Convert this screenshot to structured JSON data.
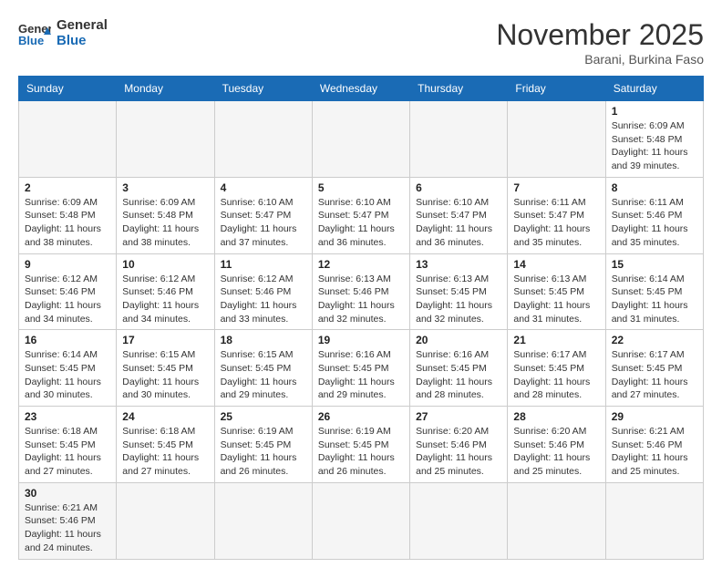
{
  "header": {
    "logo_general": "General",
    "logo_blue": "Blue",
    "month_title": "November 2025",
    "location": "Barani, Burkina Faso"
  },
  "weekdays": [
    "Sunday",
    "Monday",
    "Tuesday",
    "Wednesday",
    "Thursday",
    "Friday",
    "Saturday"
  ],
  "weeks": [
    [
      {
        "day": "",
        "empty": true
      },
      {
        "day": "",
        "empty": true
      },
      {
        "day": "",
        "empty": true
      },
      {
        "day": "",
        "empty": true
      },
      {
        "day": "",
        "empty": true
      },
      {
        "day": "",
        "empty": true
      },
      {
        "day": "1",
        "sunrise": "6:09 AM",
        "sunset": "5:48 PM",
        "daylight": "11 hours and 39 minutes."
      }
    ],
    [
      {
        "day": "2",
        "sunrise": "6:09 AM",
        "sunset": "5:48 PM",
        "daylight": "11 hours and 38 minutes."
      },
      {
        "day": "3",
        "sunrise": "6:09 AM",
        "sunset": "5:48 PM",
        "daylight": "11 hours and 38 minutes."
      },
      {
        "day": "4",
        "sunrise": "6:10 AM",
        "sunset": "5:47 PM",
        "daylight": "11 hours and 37 minutes."
      },
      {
        "day": "5",
        "sunrise": "6:10 AM",
        "sunset": "5:47 PM",
        "daylight": "11 hours and 36 minutes."
      },
      {
        "day": "6",
        "sunrise": "6:10 AM",
        "sunset": "5:47 PM",
        "daylight": "11 hours and 36 minutes."
      },
      {
        "day": "7",
        "sunrise": "6:11 AM",
        "sunset": "5:47 PM",
        "daylight": "11 hours and 35 minutes."
      },
      {
        "day": "8",
        "sunrise": "6:11 AM",
        "sunset": "5:46 PM",
        "daylight": "11 hours and 35 minutes."
      }
    ],
    [
      {
        "day": "9",
        "sunrise": "6:12 AM",
        "sunset": "5:46 PM",
        "daylight": "11 hours and 34 minutes."
      },
      {
        "day": "10",
        "sunrise": "6:12 AM",
        "sunset": "5:46 PM",
        "daylight": "11 hours and 34 minutes."
      },
      {
        "day": "11",
        "sunrise": "6:12 AM",
        "sunset": "5:46 PM",
        "daylight": "11 hours and 33 minutes."
      },
      {
        "day": "12",
        "sunrise": "6:13 AM",
        "sunset": "5:46 PM",
        "daylight": "11 hours and 32 minutes."
      },
      {
        "day": "13",
        "sunrise": "6:13 AM",
        "sunset": "5:45 PM",
        "daylight": "11 hours and 32 minutes."
      },
      {
        "day": "14",
        "sunrise": "6:13 AM",
        "sunset": "5:45 PM",
        "daylight": "11 hours and 31 minutes."
      },
      {
        "day": "15",
        "sunrise": "6:14 AM",
        "sunset": "5:45 PM",
        "daylight": "11 hours and 31 minutes."
      }
    ],
    [
      {
        "day": "16",
        "sunrise": "6:14 AM",
        "sunset": "5:45 PM",
        "daylight": "11 hours and 30 minutes."
      },
      {
        "day": "17",
        "sunrise": "6:15 AM",
        "sunset": "5:45 PM",
        "daylight": "11 hours and 30 minutes."
      },
      {
        "day": "18",
        "sunrise": "6:15 AM",
        "sunset": "5:45 PM",
        "daylight": "11 hours and 29 minutes."
      },
      {
        "day": "19",
        "sunrise": "6:16 AM",
        "sunset": "5:45 PM",
        "daylight": "11 hours and 29 minutes."
      },
      {
        "day": "20",
        "sunrise": "6:16 AM",
        "sunset": "5:45 PM",
        "daylight": "11 hours and 28 minutes."
      },
      {
        "day": "21",
        "sunrise": "6:17 AM",
        "sunset": "5:45 PM",
        "daylight": "11 hours and 28 minutes."
      },
      {
        "day": "22",
        "sunrise": "6:17 AM",
        "sunset": "5:45 PM",
        "daylight": "11 hours and 27 minutes."
      }
    ],
    [
      {
        "day": "23",
        "sunrise": "6:18 AM",
        "sunset": "5:45 PM",
        "daylight": "11 hours and 27 minutes."
      },
      {
        "day": "24",
        "sunrise": "6:18 AM",
        "sunset": "5:45 PM",
        "daylight": "11 hours and 27 minutes."
      },
      {
        "day": "25",
        "sunrise": "6:19 AM",
        "sunset": "5:45 PM",
        "daylight": "11 hours and 26 minutes."
      },
      {
        "day": "26",
        "sunrise": "6:19 AM",
        "sunset": "5:45 PM",
        "daylight": "11 hours and 26 minutes."
      },
      {
        "day": "27",
        "sunrise": "6:20 AM",
        "sunset": "5:46 PM",
        "daylight": "11 hours and 25 minutes."
      },
      {
        "day": "28",
        "sunrise": "6:20 AM",
        "sunset": "5:46 PM",
        "daylight": "11 hours and 25 minutes."
      },
      {
        "day": "29",
        "sunrise": "6:21 AM",
        "sunset": "5:46 PM",
        "daylight": "11 hours and 25 minutes."
      }
    ],
    [
      {
        "day": "30",
        "sunrise": "6:21 AM",
        "sunset": "5:46 PM",
        "daylight": "11 hours and 24 minutes.",
        "last": true
      },
      {
        "day": "",
        "empty": true,
        "last": true
      },
      {
        "day": "",
        "empty": true,
        "last": true
      },
      {
        "day": "",
        "empty": true,
        "last": true
      },
      {
        "day": "",
        "empty": true,
        "last": true
      },
      {
        "day": "",
        "empty": true,
        "last": true
      },
      {
        "day": "",
        "empty": true,
        "last": true
      }
    ]
  ],
  "labels": {
    "sunrise": "Sunrise:",
    "sunset": "Sunset:",
    "daylight": "Daylight:"
  }
}
